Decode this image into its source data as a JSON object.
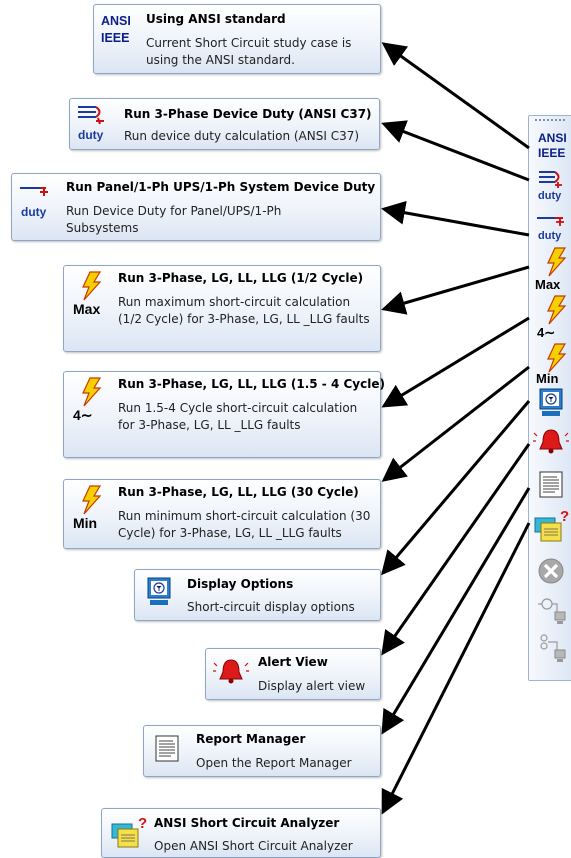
{
  "tooltips": [
    {
      "title": "Using ANSI standard",
      "desc": "Current Short Circuit study case is using the ANSI standard.",
      "icon": "ansi-ieee-icon",
      "icon_text": [
        "ANSI",
        "IEEE"
      ]
    },
    {
      "title": "Run 3-Phase Device Duty (ANSI C37)",
      "desc": "Run device duty calculation (ANSI C37)",
      "icon": "three-phase-duty-icon",
      "icon_text": "duty"
    },
    {
      "title": "Run Panel/1-Ph UPS/1-Ph System Device Duty",
      "desc": "Run Device Duty for Panel/UPS/1-Ph Subsystems",
      "icon": "single-phase-duty-icon",
      "icon_text": "duty"
    },
    {
      "title": "Run 3-Phase, LG, LL, LLG (1/2 Cycle)",
      "desc": "Run maximum short-circuit calculation (1/2 Cycle) for 3-Phase, LG, LL _LLG faults",
      "icon": "max-fault-icon",
      "icon_text": "Max"
    },
    {
      "title": "Run 3-Phase, LG, LL, LLG (1.5 - 4 Cycle)",
      "desc": "Run 1.5-4 Cycle short-circuit calculation for 3-Phase, LG, LL _LLG faults",
      "icon": "four-cycle-fault-icon",
      "icon_text": "4∼"
    },
    {
      "title": "Run 3-Phase, LG, LL, LLG (30 Cycle)",
      "desc": "Run minimum short-circuit calculation (30 Cycle) for 3-Phase, LG, LL _LLG faults",
      "icon": "min-fault-icon",
      "icon_text": "Min"
    },
    {
      "title": "Display Options",
      "desc": "Short-circuit display options",
      "icon": "display-options-icon"
    },
    {
      "title": "Alert View",
      "desc": "Display alert view",
      "icon": "alert-bell-icon"
    },
    {
      "title": "Report Manager",
      "desc": "Open the Report Manager",
      "icon": "report-manager-icon"
    },
    {
      "title": "ANSI Short Circuit Analyzer",
      "desc": "Open ANSI Short Circuit Analyzer",
      "icon": "analyzer-icon"
    }
  ],
  "toolbar": {
    "buttons": [
      "ansi-ieee-icon",
      "three-phase-duty-icon",
      "single-phase-duty-icon",
      "max-fault-icon",
      "four-cycle-fault-icon",
      "min-fault-icon",
      "display-options-icon",
      "alert-bell-icon",
      "report-manager-icon",
      "analyzer-icon",
      "stop-icon",
      "get-online-data-icon",
      "get-archived-data-icon"
    ],
    "ansi_text": [
      "ANSI",
      "IEEE"
    ],
    "duty_text": "duty",
    "max_text": "Max",
    "four_text": "4∼",
    "min_text": "Min"
  },
  "colors": {
    "tooltip_border": "#8fa7c4",
    "arrow": "#000000",
    "lightning": "#f5d000",
    "icon_blue": "#1a3a9e",
    "icon_red": "#cc1111"
  }
}
